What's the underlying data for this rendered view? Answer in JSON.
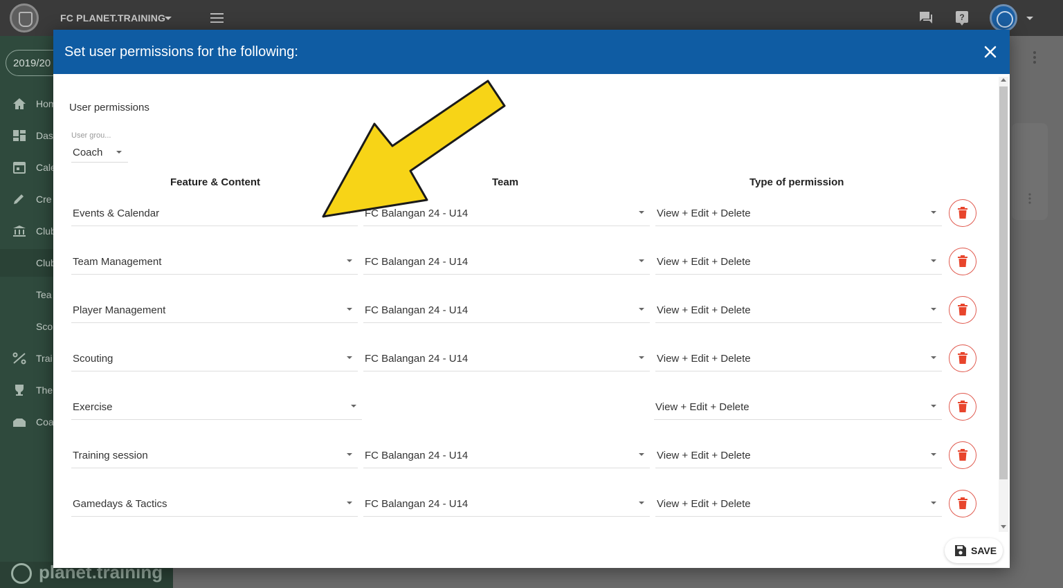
{
  "topbar": {
    "app_title": "FC PLANET.TRAINING",
    "icons": [
      "chat-icon",
      "help-icon",
      "user-avatar"
    ]
  },
  "sidebar": {
    "season": "2019/20",
    "items": [
      {
        "label": "Hom",
        "icon": "home-icon"
      },
      {
        "label": "Das",
        "icon": "dashboard-icon"
      },
      {
        "label": "Cale",
        "icon": "calendar-icon"
      },
      {
        "label": "Cre",
        "icon": "pencil-icon"
      },
      {
        "label": "Club",
        "icon": "club-icon"
      },
      {
        "label": "Club",
        "icon": ""
      },
      {
        "label": "Tea",
        "icon": ""
      },
      {
        "label": "Sco",
        "icon": ""
      },
      {
        "label": "Trai",
        "icon": "training-icon"
      },
      {
        "label": "The",
        "icon": "trophy-icon"
      },
      {
        "label": "Coa",
        "icon": "coach-icon"
      }
    ],
    "brand": "planet.training"
  },
  "modal": {
    "title": "Set user permissions for the following:",
    "section_label": "User permissions",
    "user_group_label": "User grou...",
    "user_group_value": "Coach",
    "columns": {
      "feature": "Feature & Content",
      "team": "Team",
      "permission": "Type of permission"
    },
    "rows": [
      {
        "feature": "Events & Calendar",
        "team": "FC Balangan 24 - U14",
        "permission": "View + Edit + Delete"
      },
      {
        "feature": "Team Management",
        "team": "FC Balangan 24 - U14",
        "permission": "View + Edit + Delete"
      },
      {
        "feature": "Player Management",
        "team": "FC Balangan 24 - U14",
        "permission": "View + Edit + Delete"
      },
      {
        "feature": "Scouting",
        "team": "FC Balangan 24 - U14",
        "permission": "View + Edit + Delete"
      },
      {
        "feature": "Exercise",
        "team": "",
        "permission": "View + Edit + Delete"
      },
      {
        "feature": "Training session",
        "team": "FC Balangan 24 - U14",
        "permission": "View + Edit + Delete"
      },
      {
        "feature": "Gamedays & Tactics",
        "team": "FC Balangan 24 - U14",
        "permission": "View + Edit + Delete"
      }
    ],
    "save_label": "SAVE"
  },
  "colors": {
    "header_blue": "#0f5ca3",
    "delete_red": "#e8452c",
    "annotation_arrow": "#f7d417"
  }
}
